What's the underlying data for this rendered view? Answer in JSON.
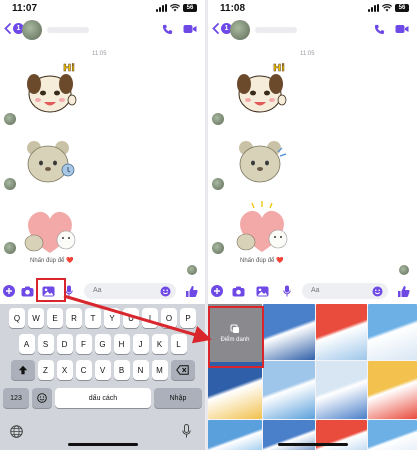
{
  "left_screen": {
    "status_time": "11:07",
    "back_badge": "1",
    "timestamp": "11:05",
    "reaction_caption": "Nhấn đúp để ❤️",
    "input_placeholder": "Aa",
    "keyboard": {
      "row1": [
        "Q",
        "W",
        "E",
        "R",
        "T",
        "Y",
        "U",
        "I",
        "O",
        "P"
      ],
      "row2": [
        "A",
        "S",
        "D",
        "F",
        "G",
        "H",
        "J",
        "K",
        "L"
      ],
      "row3": [
        "Z",
        "X",
        "C",
        "V",
        "B",
        "N",
        "M"
      ],
      "numbers_key": "123",
      "space_key": "dấu cách",
      "return_key": "Nhập"
    }
  },
  "right_screen": {
    "status_time": "11:08",
    "back_badge": "1",
    "timestamp": "11:05",
    "reaction_caption": "Nhấn đúp để ❤️",
    "input_placeholder": "Aa",
    "gallery_tile_label": "Điểm danh"
  },
  "icons": {
    "accent_color": "#6e49e6",
    "highlight_color": "#d9262c"
  },
  "status_battery": "56"
}
